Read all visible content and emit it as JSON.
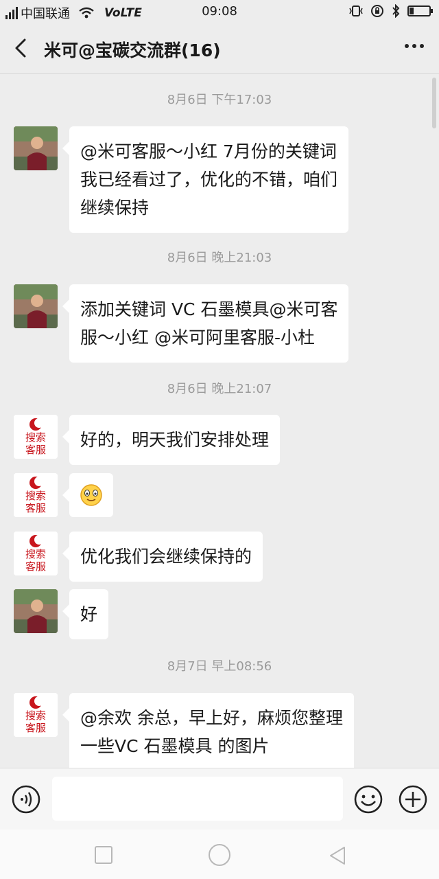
{
  "status_bar": {
    "carrier": "中国联通",
    "network": "VoLTE",
    "time": "09:08"
  },
  "header": {
    "title": "米可@宝碳交流群(16)"
  },
  "messages": [
    {
      "type": "time",
      "text": "8月6日 下午17:03"
    },
    {
      "type": "msg",
      "sender": "person",
      "lines": [
        "@米可客服～小红 7月份的关键词",
        "我已经看过了，优化的不错，咱们",
        "继续保持"
      ]
    },
    {
      "type": "time",
      "text": "8月6日 晚上21:03"
    },
    {
      "type": "msg",
      "sender": "person",
      "lines": [
        "添加关键词 VC 石墨模具@米可客",
        "服～小红  @米可阿里客服-小杜"
      ]
    },
    {
      "type": "time",
      "text": "8月6日 晚上21:07"
    },
    {
      "type": "msg",
      "sender": "service",
      "lines": [
        "好的，明天我们安排处理"
      ]
    },
    {
      "type": "emoji",
      "sender": "service",
      "icon": "smile-emoji-icon"
    },
    {
      "type": "msg",
      "sender": "service",
      "lines": [
        "优化我们会继续保持的"
      ]
    },
    {
      "type": "msg",
      "sender": "person",
      "lines": [
        "好"
      ]
    },
    {
      "type": "time",
      "text": "8月7日 早上08:56"
    },
    {
      "type": "msg",
      "sender": "service",
      "lines": [
        "@余欢 余总，早上好，麻烦您整理",
        "一些VC 石墨模具 的图片"
      ]
    }
  ],
  "service_avatar": {
    "line1": "搜索",
    "line2": "客服"
  },
  "input": {
    "value": "",
    "placeholder": ""
  },
  "icons": {
    "back": "chevron-left-icon",
    "more": "more-dots-icon",
    "voice": "voice-icon",
    "emoji": "emoji-icon",
    "plus": "plus-icon"
  },
  "colors": {
    "background": "#ededed",
    "bubble": "#ffffff",
    "service_logo_red": "#c8161d"
  }
}
